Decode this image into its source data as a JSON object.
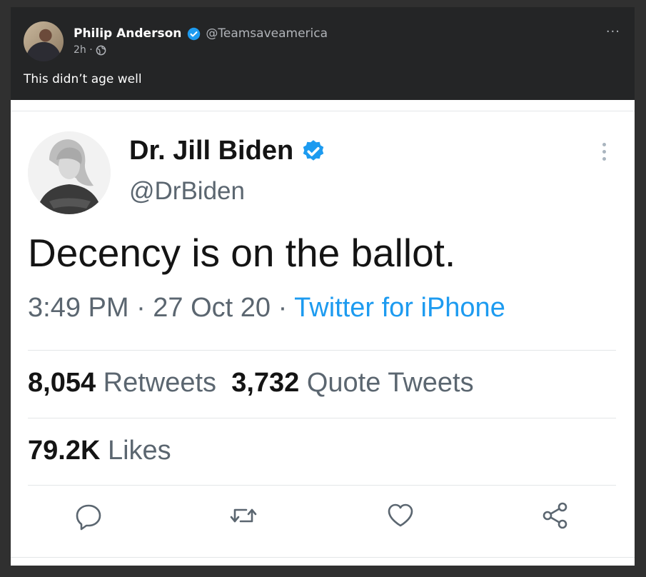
{
  "post": {
    "author_name": "Philip Anderson",
    "author_handle": "@Teamsaveamerica",
    "time": "2h ·",
    "caption": "This didn’t age well",
    "more_label": "···"
  },
  "tweet": {
    "name": "Dr. Jill Biden",
    "handle": "@DrBiden",
    "text": "Decency is on the ballot.",
    "time": "3:49 PM · 27 Oct 20 · ",
    "source": "Twitter for iPhone",
    "retweets_count": "8,054",
    "retweets_label": "Retweets",
    "quotes_count": "3,732",
    "quotes_label": "Quote Tweets",
    "likes_count": "79.2K",
    "likes_label": "Likes"
  },
  "icons": {
    "verified": "verified-badge-icon",
    "globe": "globe-icon",
    "reply": "reply-icon",
    "retweet": "retweet-icon",
    "like": "heart-icon",
    "share": "share-icon"
  },
  "colors": {
    "post_bg": "#242526",
    "verified_blue": "#1d9bf0",
    "link_blue": "#1d9bf0",
    "muted_gray": "#5b6670"
  }
}
